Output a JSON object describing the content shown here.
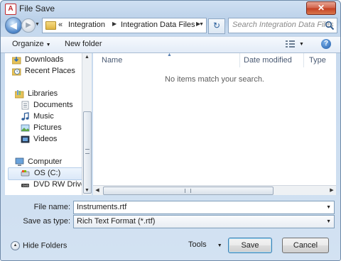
{
  "window": {
    "title": "File Save",
    "app_icon_letter": "A",
    "close_label": "✕"
  },
  "address": {
    "breadcrumb_prefix": "«",
    "path": [
      "Integration",
      "Integration Data Files"
    ],
    "search_placeholder": "Search Integration Data Files"
  },
  "toolbar": {
    "organize_label": "Organize",
    "new_folder_label": "New folder",
    "help_label": "?"
  },
  "nav_pane": {
    "favorites": [
      "Downloads",
      "Recent Places"
    ],
    "libraries_label": "Libraries",
    "libraries": [
      "Documents",
      "Music",
      "Pictures",
      "Videos"
    ],
    "computer_label": "Computer",
    "drives": [
      "OS (C:)",
      "DVD RW Drive (D"
    ],
    "selected": "OS (C:)"
  },
  "file_list": {
    "columns": [
      "Name",
      "Date modified",
      "Type"
    ],
    "empty_message": "No items match your search."
  },
  "form": {
    "file_name_label": "File name:",
    "file_name_value": "Instruments.rtf",
    "save_as_type_label": "Save as type:",
    "save_as_type_value": "Rich Text Format (*.rtf)"
  },
  "bottom": {
    "hide_folders_label": "Hide Folders",
    "tools_label": "Tools",
    "save_label": "Save",
    "cancel_label": "Cancel"
  },
  "colors": {
    "title_bar": "#c6d9ee",
    "close_button": "#c43f22",
    "selection": "#dbe8f8"
  },
  "icons": {
    "back": "back-arrow-icon",
    "forward": "forward-arrow-icon",
    "refresh": "refresh-icon",
    "search": "search-icon",
    "views": "views-icon",
    "help": "help-icon"
  }
}
